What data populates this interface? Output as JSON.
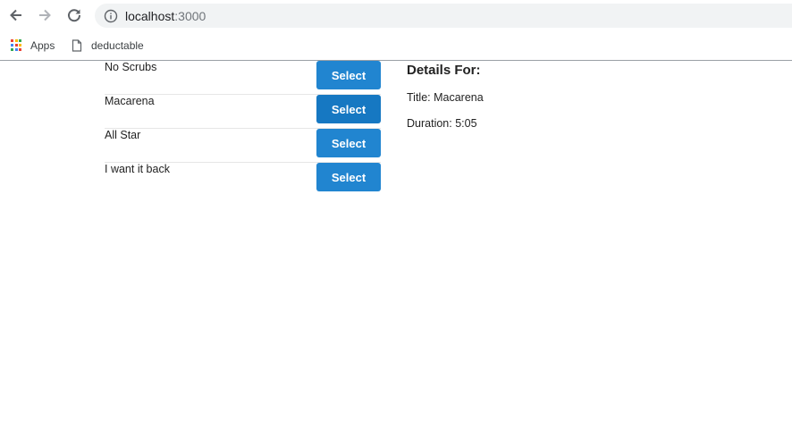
{
  "browser": {
    "url_host": "localhost",
    "url_port": ":3000",
    "bookmarks": [
      "Apps",
      "deductable"
    ]
  },
  "songs": [
    {
      "title": "No Scrubs",
      "button": "Select"
    },
    {
      "title": "Macarena",
      "button": "Select"
    },
    {
      "title": "All Star",
      "button": "Select"
    },
    {
      "title": "I want it back",
      "button": "Select"
    }
  ],
  "details": {
    "heading": "Details For:",
    "title_line": "Title: Macarena",
    "duration_line": "Duration: 5:05"
  },
  "colors": {
    "button": "#2185d0",
    "button_active": "#1678c2",
    "omnibox": "#f1f3f4"
  },
  "icons": [
    "back-arrow-icon",
    "forward-arrow-icon",
    "reload-icon",
    "info-icon",
    "apps-grid-icon",
    "page-icon"
  ]
}
